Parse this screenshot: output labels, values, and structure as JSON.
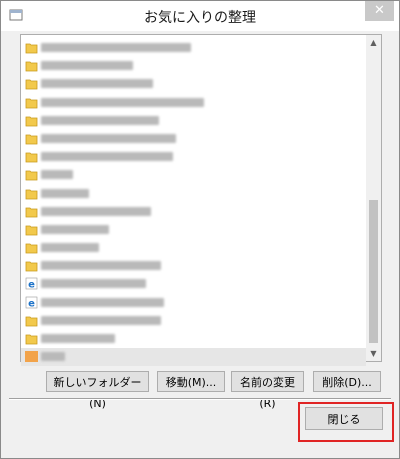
{
  "window": {
    "title": "お気に入りの整理",
    "close_glyph": "✕"
  },
  "list": {
    "items": [
      {
        "icon": "folder",
        "name": "xxxxxxxxxxxxxxxxxxxxxx"
      },
      {
        "icon": "folder",
        "name": "xxxxxxxxxxxxxx"
      },
      {
        "icon": "folder",
        "name": "xxxxxxxxxxxxxxxxx"
      },
      {
        "icon": "folder",
        "name": "xxxxxxxxxxxxxxxxxxxxxxxxx"
      },
      {
        "icon": "folder",
        "name": "xxxxxxxxxxxxxxxxxx"
      },
      {
        "icon": "folder",
        "name": "xxxxxxxxxxxxxxxxxxxxx"
      },
      {
        "icon": "folder",
        "name": "xxxxxxxxxxxxxxxxxxxxxxx"
      },
      {
        "icon": "folder",
        "name": "xxxxxx"
      },
      {
        "icon": "folder",
        "name": "xxxxxxx"
      },
      {
        "icon": "folder",
        "name": "xxxxxxxxxxxxxxxx"
      },
      {
        "icon": "folder",
        "name": "xxxxxxxxxxx"
      },
      {
        "icon": "folder",
        "name": "xxxxxxxxx"
      },
      {
        "icon": "folder",
        "name": "xxxxxxxxxxxxxxxxxx"
      },
      {
        "icon": "ie",
        "name": "xxxxxxxxxxxxxxxxx"
      },
      {
        "icon": "ie",
        "name": "xxxxxxxxxxxxxxxxxxxxx"
      },
      {
        "icon": "folder",
        "name": "xxxxxxxxxxxxxxxxxxx"
      },
      {
        "icon": "folder",
        "name": "xxxxxxxxxxx"
      },
      {
        "icon": "feed",
        "name": "xxxx",
        "selected": true
      }
    ]
  },
  "buttons": {
    "new_folder": "新しいフォルダー(N)",
    "move": "移動(M)...",
    "rename": "名前の変更(R)",
    "delete": "削除(D)...",
    "close": "閉じる"
  },
  "colors": {
    "highlight_border": "#e02424",
    "folder": "#f2c94c",
    "ie": "#1e73c8"
  }
}
